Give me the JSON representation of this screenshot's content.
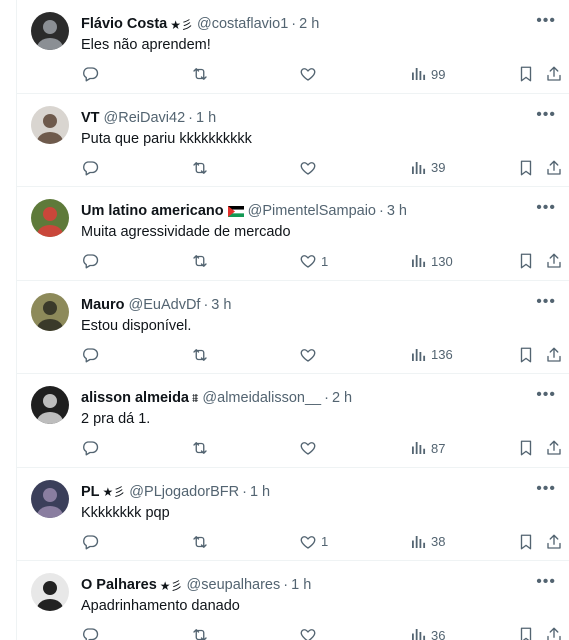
{
  "posts": [
    {
      "name": "Flávio Costa",
      "badge": "★彡",
      "flag": false,
      "handle": "@costaflavio1",
      "time": "2 h",
      "text": "Eles não aprendem!",
      "replies": "",
      "retweets": "",
      "likes": "",
      "views": "99",
      "avatar_colors": [
        "#2b2b2b",
        "#8b8f94"
      ]
    },
    {
      "name": "VT",
      "badge": "",
      "flag": false,
      "handle": "@ReiDavi42",
      "time": "1 h",
      "text": "Puta que pariu kkkkkkkkkk",
      "replies": "",
      "retweets": "",
      "likes": "",
      "views": "39",
      "avatar_colors": [
        "#d9d5d0",
        "#6e5a4c"
      ]
    },
    {
      "name": "Um latino americano",
      "badge": "",
      "flag": true,
      "handle": "@PimentelSampaio",
      "time": "3 h",
      "text": "Muita agressividade de mercado",
      "replies": "",
      "retweets": "",
      "likes": "1",
      "views": "130",
      "avatar_colors": [
        "#5e7a3a",
        "#c9473a"
      ]
    },
    {
      "name": "Mauro",
      "badge": "",
      "flag": false,
      "handle": "@EuAdvDf",
      "time": "3 h",
      "text": "Estou disponível.",
      "replies": "",
      "retweets": "",
      "likes": "",
      "views": "136",
      "avatar_colors": [
        "#8d8a5a",
        "#3a3a2a"
      ]
    },
    {
      "name": "alisson almeida",
      "badge": "⩩",
      "flag": false,
      "handle": "@almeidalisson__",
      "time": "2 h",
      "text": "2 pra dá 1.",
      "replies": "",
      "retweets": "",
      "likes": "",
      "views": "87",
      "avatar_colors": [
        "#1f1f1f",
        "#bdbdbd"
      ]
    },
    {
      "name": "PL",
      "badge": "★彡",
      "flag": false,
      "handle": "@PLjogadorBFR",
      "time": "1 h",
      "text": "Kkkkkkkk pqp",
      "replies": "",
      "retweets": "",
      "likes": "1",
      "views": "38",
      "avatar_colors": [
        "#3b3f5a",
        "#8a7ea0"
      ]
    },
    {
      "name": "O Palhares",
      "badge": "★彡",
      "flag": false,
      "handle": "@seupalhares",
      "time": "1 h",
      "text": "Apadrinhamento danado",
      "replies": "",
      "retweets": "",
      "likes": "",
      "views": "36",
      "avatar_colors": [
        "#e8e8e8",
        "#222222"
      ]
    }
  ],
  "icons": {
    "more": "more-dots-icon",
    "reply": "reply-icon",
    "retweet": "retweet-icon",
    "like": "heart-icon",
    "views": "views-chart-icon",
    "bookmark": "bookmark-icon",
    "share": "share-icon"
  },
  "ui": {
    "more_glyph": "•••",
    "separator": "·"
  }
}
